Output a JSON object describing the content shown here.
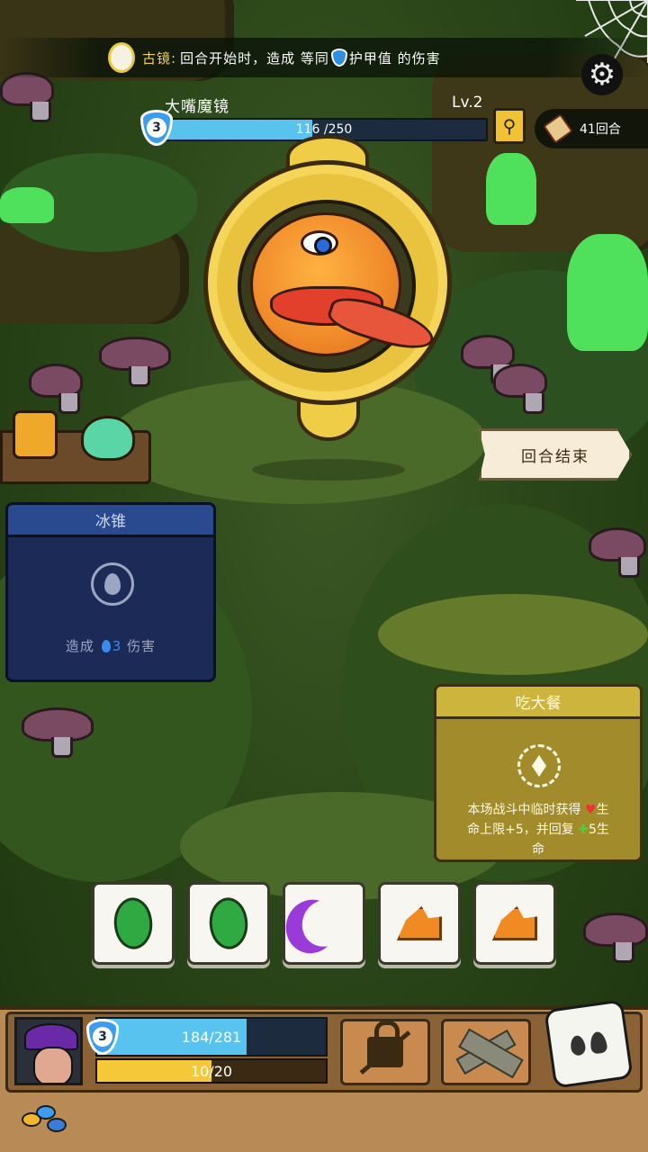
{
  "relic": {
    "name": "古镜:",
    "text_before": "回合开始时，造成 等同",
    "text_after": "护甲值 的伤害"
  },
  "enemy": {
    "name": "大嘴魔镜",
    "level": "Lv.2",
    "armor": "3",
    "hp_text": "116 /250",
    "hp_fraction": 0.464
  },
  "round_counter": "41回合",
  "end_turn_label": "回合结束",
  "skill_ice": {
    "title": "冰锥",
    "desc_before": "造成",
    "desc_value": "3",
    "desc_after": "伤害"
  },
  "skill_meal": {
    "title": "吃大餐",
    "desc_line1_before": "本场战斗中临时获得",
    "desc_line1_after": "生",
    "desc_line2_before": "命上限+5，并回复",
    "desc_line2_after": "5生",
    "desc_line3": "命"
  },
  "dice_tiles": [
    "leaf-icon",
    "leaf-icon",
    "moon-icon",
    "rock-icon",
    "rock-icon"
  ],
  "player": {
    "armor": "3",
    "hp_text": "184/281",
    "hp_fraction": 0.655,
    "xp_text": "10/20",
    "xp_fraction": 0.5
  },
  "colors": {
    "hp": "#59c3f0",
    "xp": "#f5c83a",
    "relic_name": "#f3d24a",
    "ice_card": "#1c2a58",
    "meal_card": "#a28b2a"
  }
}
